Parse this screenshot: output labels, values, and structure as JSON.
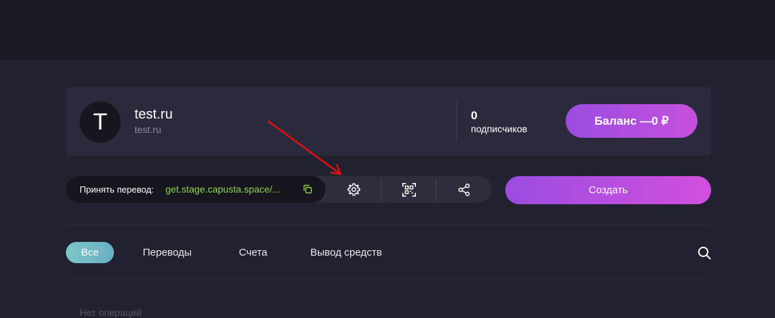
{
  "profile": {
    "avatar_letter": "T",
    "title": "test.ru",
    "subtitle": "test.ru",
    "subscribers_count": "0",
    "subscribers_label": "подписчиков",
    "balance_label": "Баланс —0 ₽"
  },
  "transfer": {
    "label": "Принять перевод:",
    "link": "get.stage.capusta.space/..."
  },
  "tools": {
    "icons": [
      "gear-icon",
      "qr-code-icon",
      "share-icon"
    ]
  },
  "create_label": "Создать",
  "tabs": [
    {
      "label": "Все",
      "active": true
    },
    {
      "label": "Переводы",
      "active": false
    },
    {
      "label": "Счета",
      "active": false
    },
    {
      "label": "Вывод средств",
      "active": false
    }
  ],
  "empty_text": "Нет операций",
  "colors": {
    "accent_start": "#9a4de0",
    "accent_end": "#d24fde",
    "tab_active": "#7cc5c7",
    "link_green": "#8cd44c",
    "annotation_arrow": "#e01010"
  }
}
